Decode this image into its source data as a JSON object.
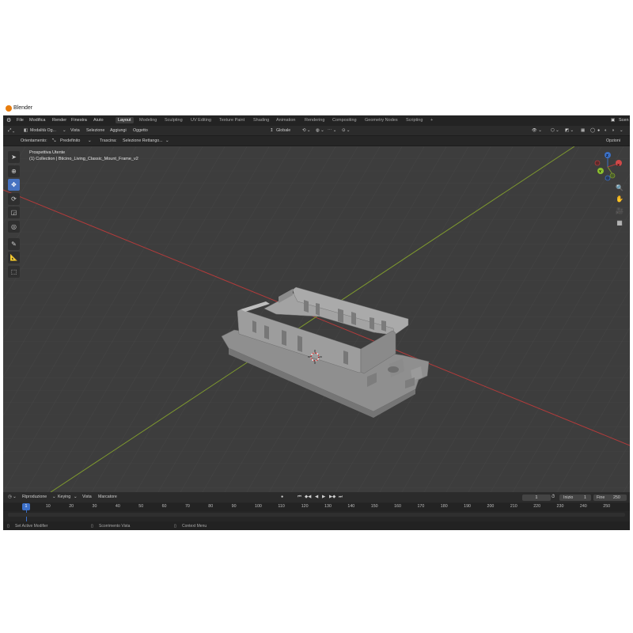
{
  "window": {
    "title": "Blender"
  },
  "menu": {
    "items": [
      "File",
      "Modifica",
      "Render",
      "Finestra",
      "Aiuto"
    ],
    "workspaces": [
      "Layout",
      "Modeling",
      "Sculpting",
      "UV Editing",
      "Texture Paint",
      "Shading",
      "Animation",
      "Rendering",
      "Compositing",
      "Geometry Nodes",
      "Scripting"
    ],
    "active_workspace": "Layout",
    "add_tab": "+",
    "scene_label": "Scen"
  },
  "header": {
    "mode": "Modalità Og...",
    "menus": [
      "Vista",
      "Selezione",
      "Aggiungi",
      "Oggetto"
    ],
    "transform": "Globale",
    "orientation_label": "Orientamento:",
    "orientation_value": "Predefinito",
    "drag_label": "Trascina:",
    "drag_value": "Selezione Rettango...",
    "options": "Opzioni"
  },
  "viewport": {
    "view_name": "Prospettiva Utente",
    "collection_info": "(1) Collection | Bticino_Living_Classic_Mount_Frame_v2",
    "gizmo_axes": [
      "X",
      "Y",
      "Z"
    ]
  },
  "timeline": {
    "menus": [
      "Riproduzione",
      "Keying",
      "Vista",
      "Marcatore"
    ],
    "current_frame": "1",
    "start_label": "Inizio",
    "start_value": "1",
    "end_label": "Fine",
    "end_value": "250",
    "ticks": [
      "1",
      "10",
      "20",
      "30",
      "40",
      "50",
      "60",
      "70",
      "80",
      "90",
      "100",
      "110",
      "120",
      "130",
      "140",
      "150",
      "160",
      "170",
      "180",
      "190",
      "200",
      "210",
      "220",
      "230",
      "240",
      "250"
    ]
  },
  "status": {
    "left": "Set Active Modifier",
    "middle": "Scorrimento Vista",
    "right": "Context Menu"
  },
  "colors": {
    "accent": "#4672c0",
    "x_axis": "#b33b3b",
    "y_axis": "#7f9a2e",
    "model": "#9c9c9c"
  }
}
